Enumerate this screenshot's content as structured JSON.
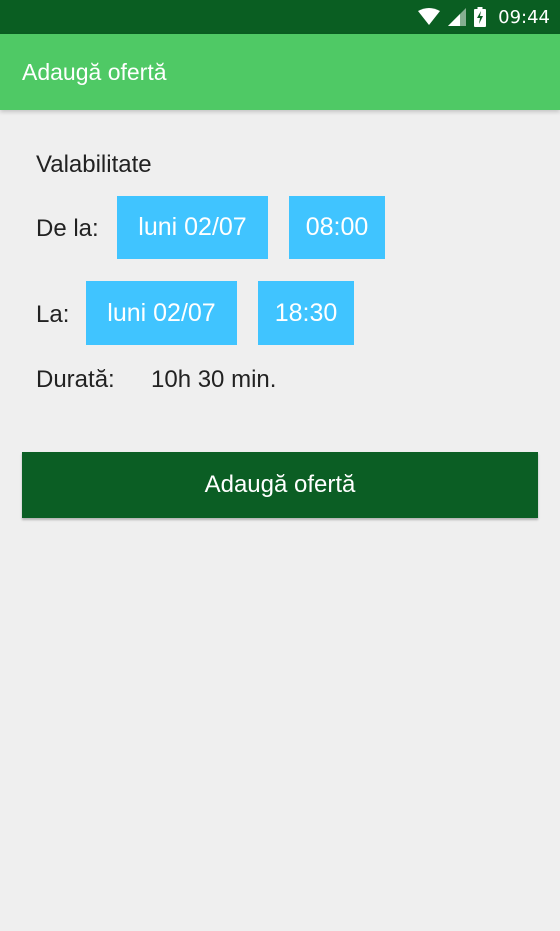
{
  "status_bar": {
    "time": "09:44",
    "icons": [
      "wifi-icon",
      "cell-signal-icon",
      "battery-charging-icon"
    ],
    "color": "#0a5e22"
  },
  "app_bar": {
    "title": "Adaugă ofertă",
    "color": "#4fc965"
  },
  "form": {
    "section_title": "Valabilitate",
    "from": {
      "label": "De la:",
      "date": "luni 02/07",
      "time": "08:00"
    },
    "to": {
      "label": "La:",
      "date": "luni 02/07",
      "time": "18:30"
    },
    "duration": {
      "label": "Durată:",
      "value": "10h 30 min."
    },
    "chip_color": "#40c4ff"
  },
  "actions": {
    "submit_label": "Adaugă ofertă",
    "color": "#0b5e24"
  }
}
